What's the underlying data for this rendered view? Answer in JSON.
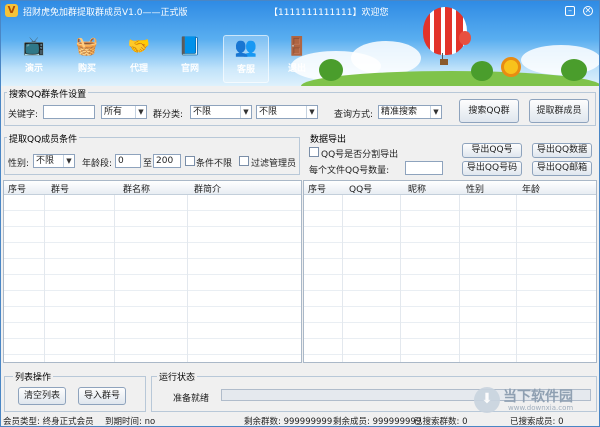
{
  "titlebar": {
    "title": "招财虎免加群提取群成员V1.0——正式版",
    "welcome": "【1111111111111】欢迎您",
    "min": "–",
    "close": "✕"
  },
  "toolbar": [
    {
      "label": "演示",
      "icon": "tv-icon",
      "glyph": "📺"
    },
    {
      "label": "购买",
      "icon": "basket-icon",
      "glyph": "🧺"
    },
    {
      "label": "代理",
      "icon": "handshake-icon",
      "glyph": "🤝"
    },
    {
      "label": "官网",
      "icon": "book-icon",
      "glyph": "📘"
    },
    {
      "label": "客服",
      "icon": "people-icon",
      "glyph": "👥"
    },
    {
      "label": "退出",
      "icon": "exit-door-icon",
      "glyph": "🚪"
    }
  ],
  "search": {
    "group_label": "搜索QQ群条件设置",
    "keyword_label": "关键字:",
    "keyword_value": "",
    "scope_value": "所有",
    "category_label": "群分类:",
    "category_value": "不限",
    "subcategory_value": "不限",
    "method_label": "查询方式:",
    "method_value": "精准搜索",
    "search_btn": "搜索QQ群",
    "extract_btn": "提取群成员"
  },
  "member": {
    "group_label": "提取QQ成员条件",
    "gender_label": "性别:",
    "gender_value": "不限",
    "age_label": "年龄段:",
    "age_from": "0",
    "age_to_label": "至",
    "age_to": "200",
    "age_unlimited_label": "条件不限",
    "filter_admin_label": "过滤管理员"
  },
  "export": {
    "group_label": "数据导出",
    "split_label": "QQ号是否分割导出",
    "per_file_label": "每个文件QQ号数量:",
    "per_file_value": "",
    "btn_qq": "导出QQ号",
    "btn_data": "导出QQ数据",
    "btn_qqpwd": "导出QQ号码",
    "btn_email": "导出QQ邮箱"
  },
  "group_table": {
    "columns": [
      "序号",
      "群号",
      "群名称",
      "群简介"
    ],
    "rows": []
  },
  "member_table": {
    "columns": [
      "序号",
      "QQ号",
      "昵称",
      "性别",
      "年龄"
    ],
    "rows": []
  },
  "list_ops": {
    "group_label": "列表操作",
    "clear_btn": "清空列表",
    "import_btn": "导入群号"
  },
  "run": {
    "group_label": "运行状态",
    "status_text": "准备就绪",
    "progress": 0
  },
  "statusbar": {
    "member_type": "会员类型: 终身正式会员",
    "expire": "到期时间: no",
    "remaining_groups": "剩余群数: 999999999",
    "remaining_members": "剩余成员: 999999999",
    "searched_groups": "已搜索群数: 0",
    "searched_members": "已搜索成员: 0"
  },
  "watermark": {
    "text": "当下软件园",
    "sub": "www.downxia.com"
  },
  "colors": {
    "banner_top": "#2f8be4",
    "banner_bottom": "#dff1fc",
    "window_border": "#4a86c5"
  }
}
